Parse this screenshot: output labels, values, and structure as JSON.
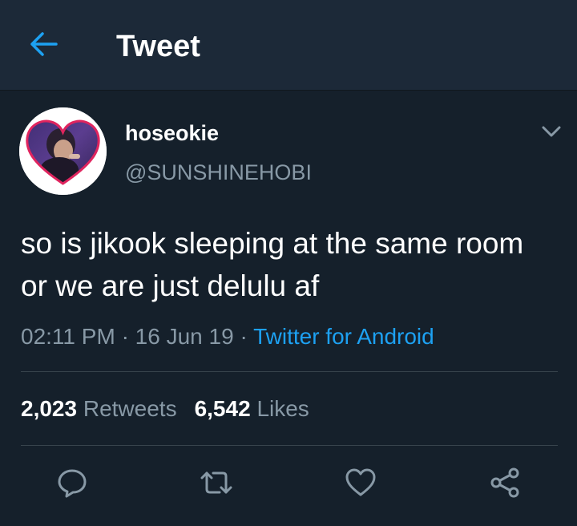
{
  "header": {
    "back_icon": "arrow-left-icon",
    "title": "Tweet"
  },
  "tweet": {
    "author": {
      "display_name": "hoseokie",
      "handle": "@SUNSHINEHOBI",
      "avatar_icon": "heart-avatar"
    },
    "more_icon": "chevron-down-icon",
    "text": "so is jikook sleeping at the same room or we are just delulu af",
    "time": "02:11 PM",
    "separator": "·",
    "date": "16 Jun 19",
    "source": "Twitter for Android",
    "stats": {
      "retweets_count": "2,023",
      "retweets_label": "Retweets",
      "likes_count": "6,542",
      "likes_label": "Likes"
    }
  },
  "actions": [
    {
      "name": "reply",
      "icon": "reply-icon"
    },
    {
      "name": "retweet",
      "icon": "retweet-icon"
    },
    {
      "name": "like",
      "icon": "heart-icon"
    },
    {
      "name": "share",
      "icon": "share-icon"
    }
  ],
  "colors": {
    "background": "#15202b",
    "header_bg": "#1c2938",
    "accent": "#1da1f2",
    "secondary_text": "#8899a6",
    "divider": "#38444d"
  }
}
